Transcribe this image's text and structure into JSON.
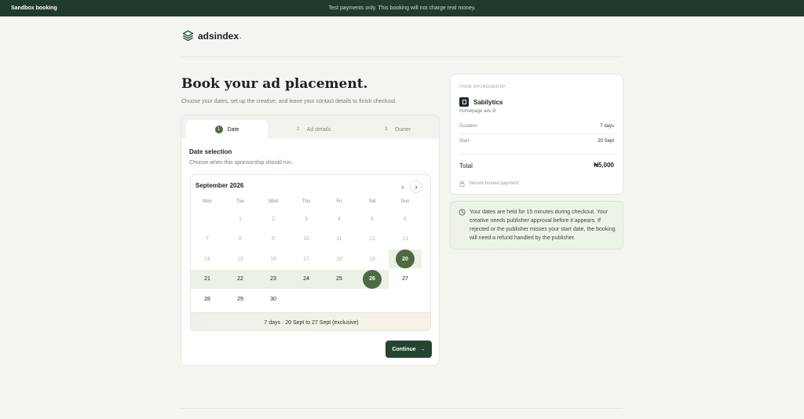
{
  "topbar": {
    "title": "Sandbox booking",
    "note": "Test payments only. This booking will not charge real money."
  },
  "logo": {
    "text": "adsindex",
    "dot": "."
  },
  "page": {
    "title": "Book your ad placement.",
    "subtitle": "Choose your dates, set up the creative, and leave your contact details to finish checkout."
  },
  "steps": [
    {
      "num": "1",
      "label": "Date",
      "active": true
    },
    {
      "num": "2",
      "label": "Ad details",
      "active": false
    },
    {
      "num": "3",
      "label": "Owner",
      "active": false
    }
  ],
  "date_section": {
    "title": "Date selection",
    "subtitle": "Choose when this sponsorship should run."
  },
  "calendar": {
    "month": "September 2026",
    "prev_icon": "‹",
    "next_icon": "›",
    "weekdays": [
      "Mon",
      "Tue",
      "Wed",
      "Thu",
      "Fri",
      "Sat",
      "Sun"
    ],
    "first_weekday_index": 1,
    "days_in_month": 30,
    "available_from": 20,
    "range_start": 20,
    "range_end": 26,
    "range_summary": "7 days · 20 Sept to 27 Sept (exclusive)"
  },
  "continue_button": {
    "label": "Continue",
    "icon": "→"
  },
  "summary": {
    "eyebrow": "YOUR SPONSORSHIP",
    "brand": "Sabilytics",
    "slot": "Homepage ads B",
    "duration_label": "Duration",
    "duration_value": "7 days",
    "start_label": "Start",
    "start_value": "20 Sept",
    "total_label": "Total",
    "total_value": "₦5,000",
    "secure_note": "Secure hosted payment"
  },
  "notice": {
    "text": "Your dates are held for 15 minutes during checkout. Your creative needs publisher approval before it appears. If rejected or the publisher misses your start date, the booking will need a refund handled by the publisher."
  },
  "colors": {
    "topbar": "#1f3b2c",
    "accent": "#4d6b3e",
    "button": "#24452f",
    "range_band": "#ebf1e5",
    "notice_bg": "#eef3e8"
  }
}
